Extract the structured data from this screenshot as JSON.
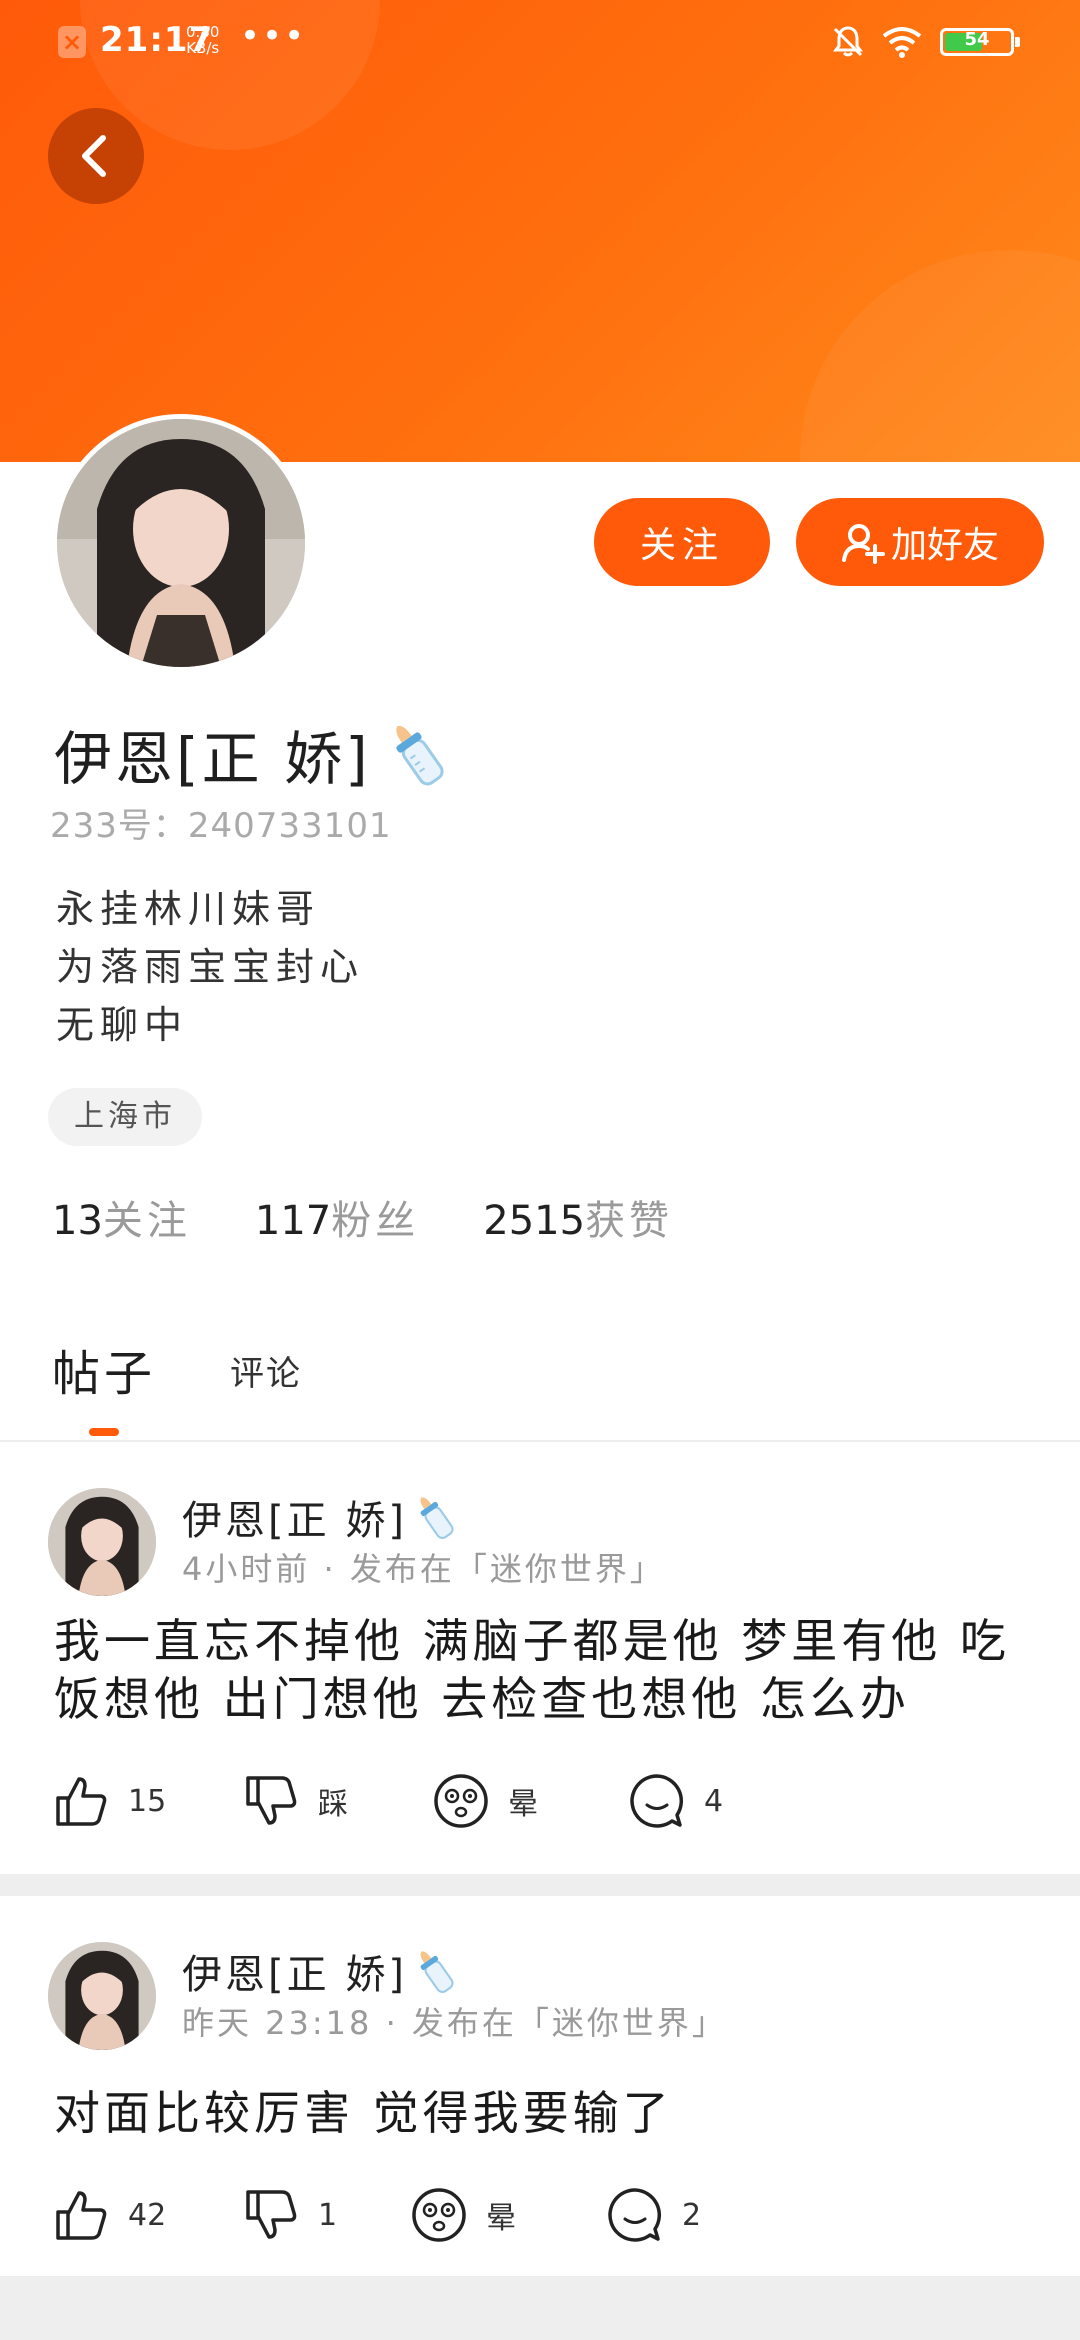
{
  "status_bar": {
    "time": "21:17",
    "net_speed_value": "0.80",
    "net_speed_unit": "KB/s",
    "battery": "54"
  },
  "profile": {
    "name": "伊恩[正 娇]",
    "id_line": "233号：240733101",
    "bio": [
      "永挂林川妹哥",
      "为落雨宝宝封心",
      "无聊中"
    ],
    "location": "上海市",
    "stats": [
      {
        "value": "13",
        "label": "关注"
      },
      {
        "value": "117",
        "label": "粉丝"
      },
      {
        "value": "2515",
        "label": "获赞"
      }
    ],
    "follow_label": "关注",
    "add_friend_label": "加好友"
  },
  "tabs": {
    "posts": "帖子",
    "comments": "评论"
  },
  "posts": [
    {
      "author": "伊恩[正 娇]",
      "meta": "4小时前 · 发布在「迷你世界」",
      "text": "我一直忘不掉他 满脑子都是他 梦里有他 吃饭想他 出门想他 去检查也想他 怎么办",
      "likes": "15",
      "dislike_label": "踩",
      "dizzy_label": "晕",
      "comments": "4"
    },
    {
      "author": "伊恩[正 娇]",
      "meta": "昨天 23:18 · 发布在「迷你世界」",
      "text": "对面比较厉害 觉得我要输了",
      "likes": "42",
      "dislike_label": "1",
      "dizzy_label": "晕",
      "comments": "2"
    }
  ],
  "colors": {
    "accent": "#ff5a0a",
    "banner_end": "#ff8a1c"
  }
}
